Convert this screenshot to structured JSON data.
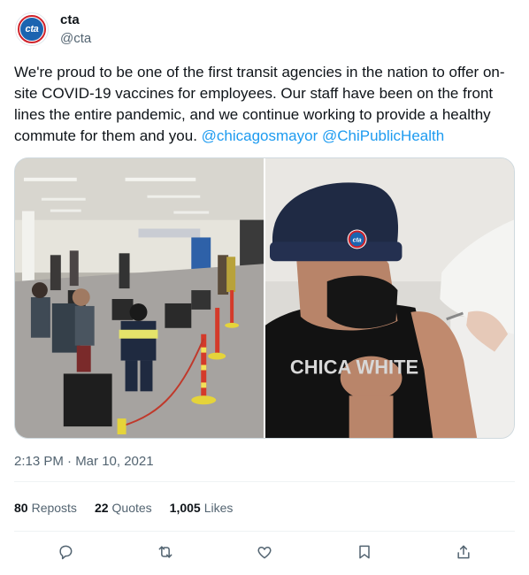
{
  "account": {
    "display_name": "cta",
    "handle": "@cta",
    "avatar_text": "cta"
  },
  "tweet": {
    "text_part1": "We're proud to be one of the first transit agencies in the nation to offer on-site COVID-19 vaccines for employees. Our staff have been on the front lines the entire pandemic, and we continue working to provide a healthy commute for them and you. ",
    "mention_1": "@chicagosmayor",
    "mention_2": "@ChiPublicHealth",
    "timestamp": "2:13 PM · Mar 10, 2021"
  },
  "media": {
    "left_photo": "vaccination-waiting-area-photo",
    "right_photo": "employee-receiving-vaccine-photo",
    "hat_logo_text": "cta",
    "shirt_text": "CHICA WHITE"
  },
  "stats": {
    "reposts_count": "80",
    "reposts_label": "Reposts",
    "quotes_count": "22",
    "quotes_label": "Quotes",
    "likes_count": "1,005",
    "likes_label": "Likes"
  },
  "actions": [
    "reply-icon",
    "repost-icon",
    "like-icon",
    "bookmark-icon",
    "share-icon"
  ],
  "colors": {
    "link": "#1d9bf0",
    "muted": "#536471",
    "cta_blue": "#1b64b0",
    "cta_red": "#d0232b"
  }
}
